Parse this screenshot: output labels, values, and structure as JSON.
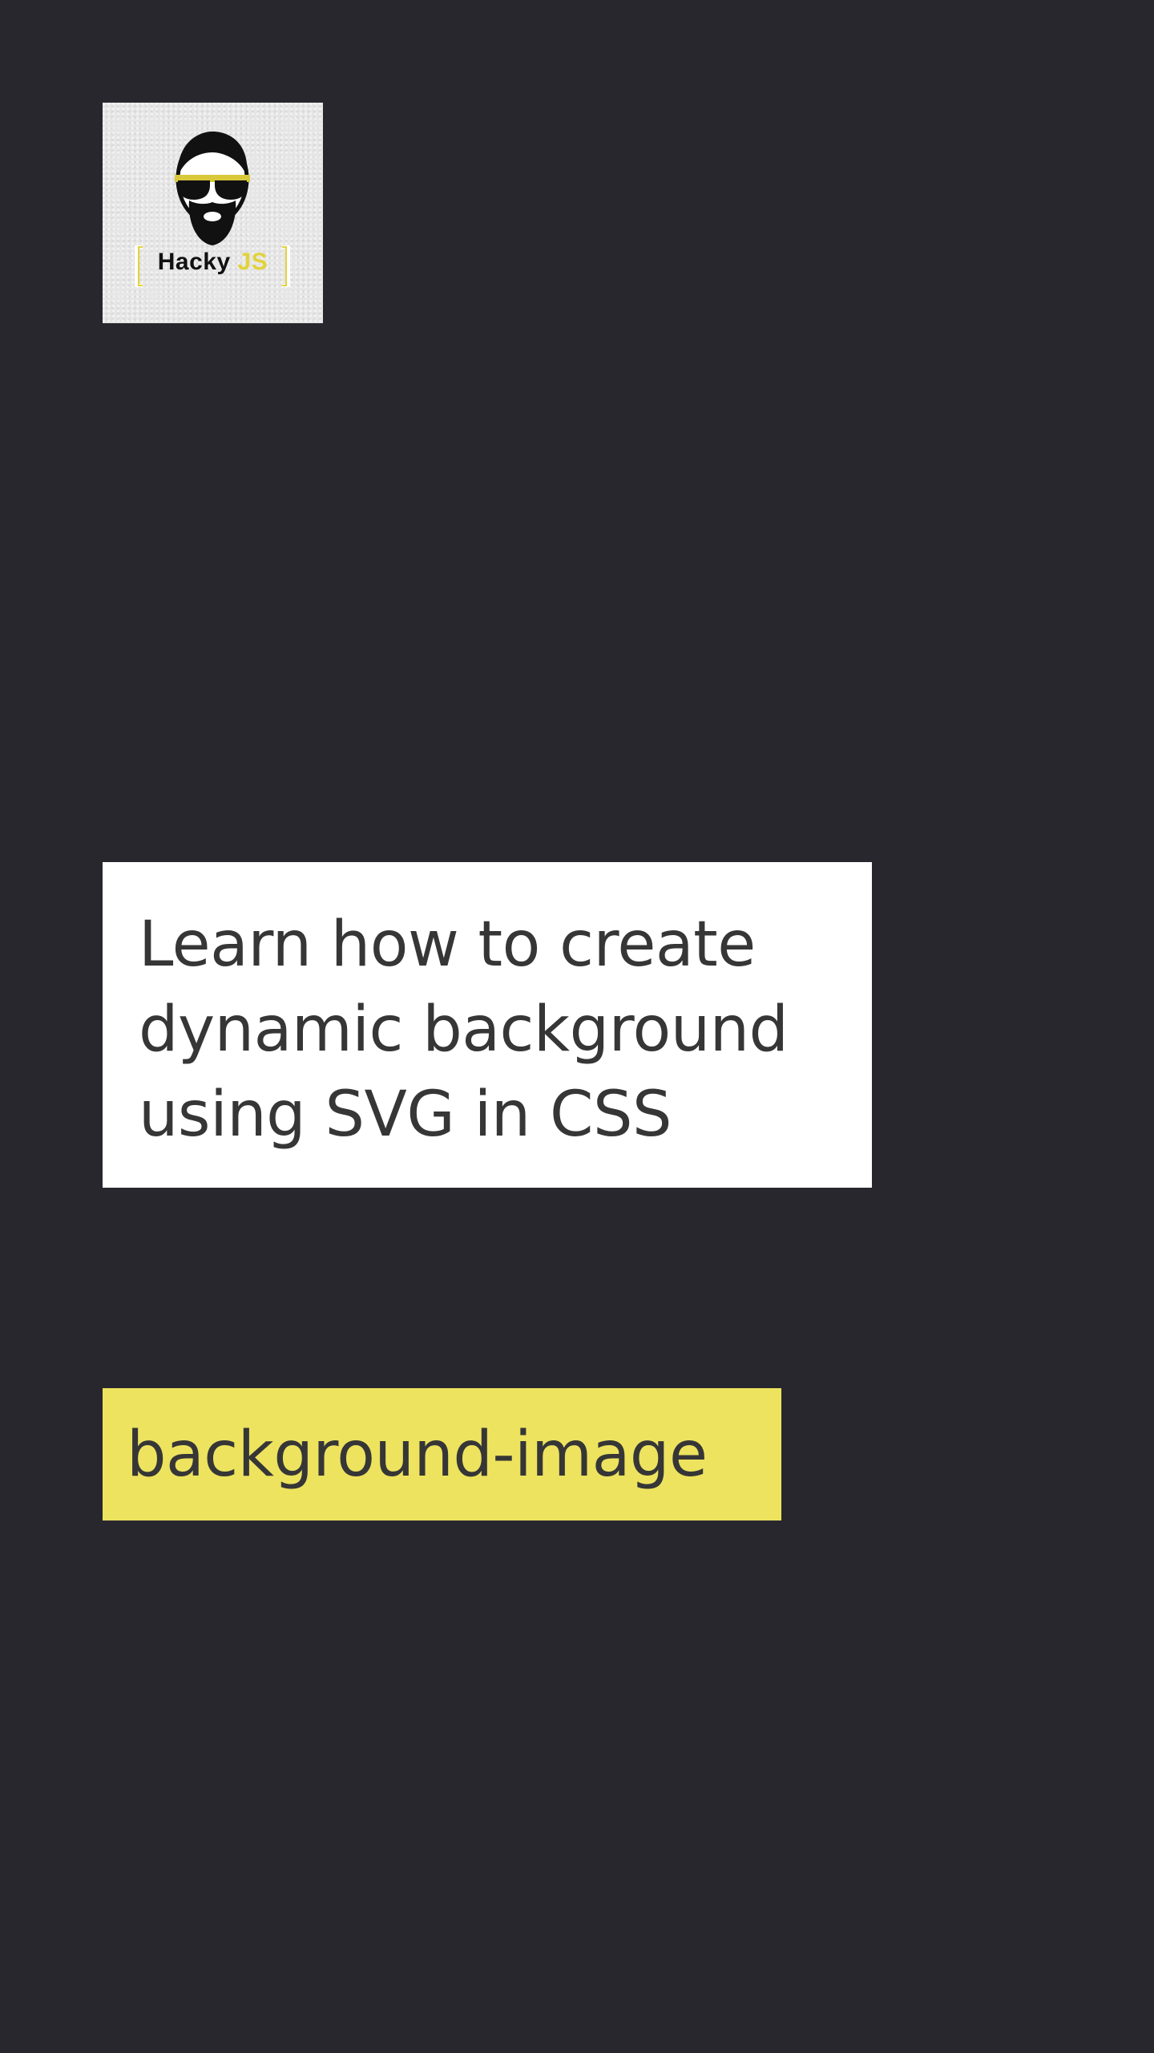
{
  "logo": {
    "brand_name": "Hacky",
    "brand_suffix": "JS",
    "icon": "bearded-sunglasses-avatar-icon",
    "accent_color": "#e2d23a"
  },
  "headline": {
    "text": "Learn how to create dynamic background using SVG in CSS"
  },
  "tag": {
    "label": "background-image",
    "color": "#ede35f"
  },
  "colors": {
    "background": "#28272e",
    "card": "#ffffff",
    "text": "#363636"
  }
}
